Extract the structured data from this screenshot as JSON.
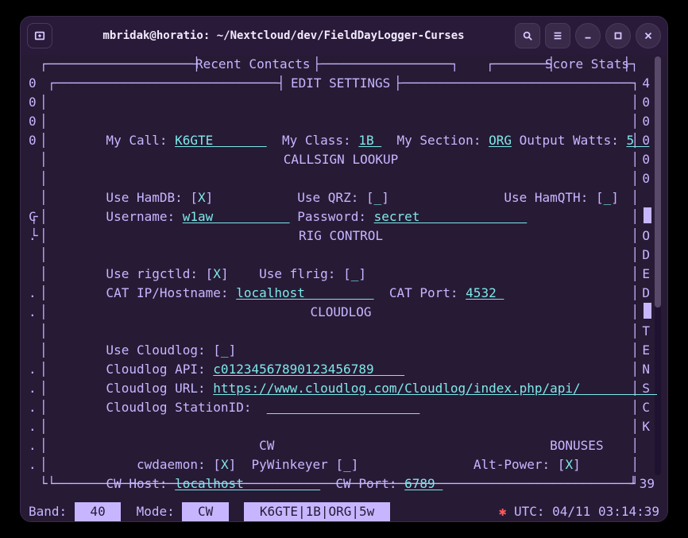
{
  "window_title": "mbridak@horatio: ~/Nextcloud/dev/FieldDayLogger-Curses",
  "recent_contacts_label": "Recent Contacts",
  "score_stats_label": "Score Stats",
  "edit_settings_label": "EDIT SETTINGS",
  "left_col": [
    "0",
    "0",
    "0",
    "0",
    "",
    "",
    "C",
    ".",
    "",
    ".",
    ".",
    "",
    "",
    ".",
    ".",
    ".",
    ".",
    ".",
    ".",
    "."
  ],
  "right_col": [
    "4",
    "0",
    "0",
    "0",
    "0",
    "0",
    "",
    "O",
    "D",
    "E",
    "D",
    "",
    "T",
    "E",
    "N",
    "S",
    "C",
    "K",
    "",
    "39"
  ],
  "form": {
    "mycall_label": " My Call: ",
    "mycall": "K6GTE       ",
    "myclass_label": "  My Class: ",
    "myclass": "1B ",
    "mysection_label": "  My Section: ",
    "mysection": "ORG",
    "watts_label": " Output Watts: ",
    "watts": "5  ",
    "callsign_lookup_title": "CALLSIGN LOOKUP",
    "use_hamdb_label": " Use HamDB: [",
    "use_hamdb": "X",
    "use_qrz_label": "Use QRZ: [",
    "use_qrz": "_",
    "use_hamqth_label": "Use HamQTH: [",
    "use_hamqth": "_",
    "username_label": " Username: ",
    "username": "w1aw          ",
    "password_label": " Password: ",
    "password": "secret              ",
    "rig_control_title": "RIG CONTROL",
    "use_rigctld_label": " Use rigctld: [",
    "use_rigctld": "X",
    "use_flrig_label": "Use flrig: [",
    "use_flrig": "_",
    "cat_ip_label": " CAT IP/Hostname: ",
    "cat_ip": "localhost         ",
    "cat_port_label": "  CAT Port: ",
    "cat_port": "4532 ",
    "cloudlog_title": "CLOUDLOG",
    "use_cloudlog_label": " Use Cloudlog: [",
    "use_cloudlog": "_",
    "cloudlog_api_label": " Cloudlog API: ",
    "cloudlog_api": "c01234567890123456789    ",
    "cloudlog_url_label": " Cloudlog URL: ",
    "cloudlog_url": "https://www.cloudlog.com/Cloudlog/index.php/api/          ",
    "cloudlog_station_label": " Cloudlog StationID:  ",
    "cloudlog_station": "                    ",
    "cw_title": "CW",
    "bonuses_title": "BONUSES",
    "cwdaemon_label": "cwdaemon: [",
    "cwdaemon": "X",
    "pywinkeyer_label": "PyWinkeyer [",
    "pywinkeyer": "_",
    "altpower_label": "Alt-Power: [",
    "altpower": "X",
    "cwhost_label": " CW Host: ",
    "cwhost": "localhost          ",
    "cwport_label": "  CW Port: ",
    "cwport": "6789 "
  },
  "status": {
    "band_label": "Band: ",
    "band": " 40 ",
    "mode_label": "  Mode: ",
    "mode": " CW ",
    "ident": " K6GTE|1B|ORG|5w ",
    "utc_label": " UTC: ",
    "utc": "04/11 03:14:39"
  }
}
